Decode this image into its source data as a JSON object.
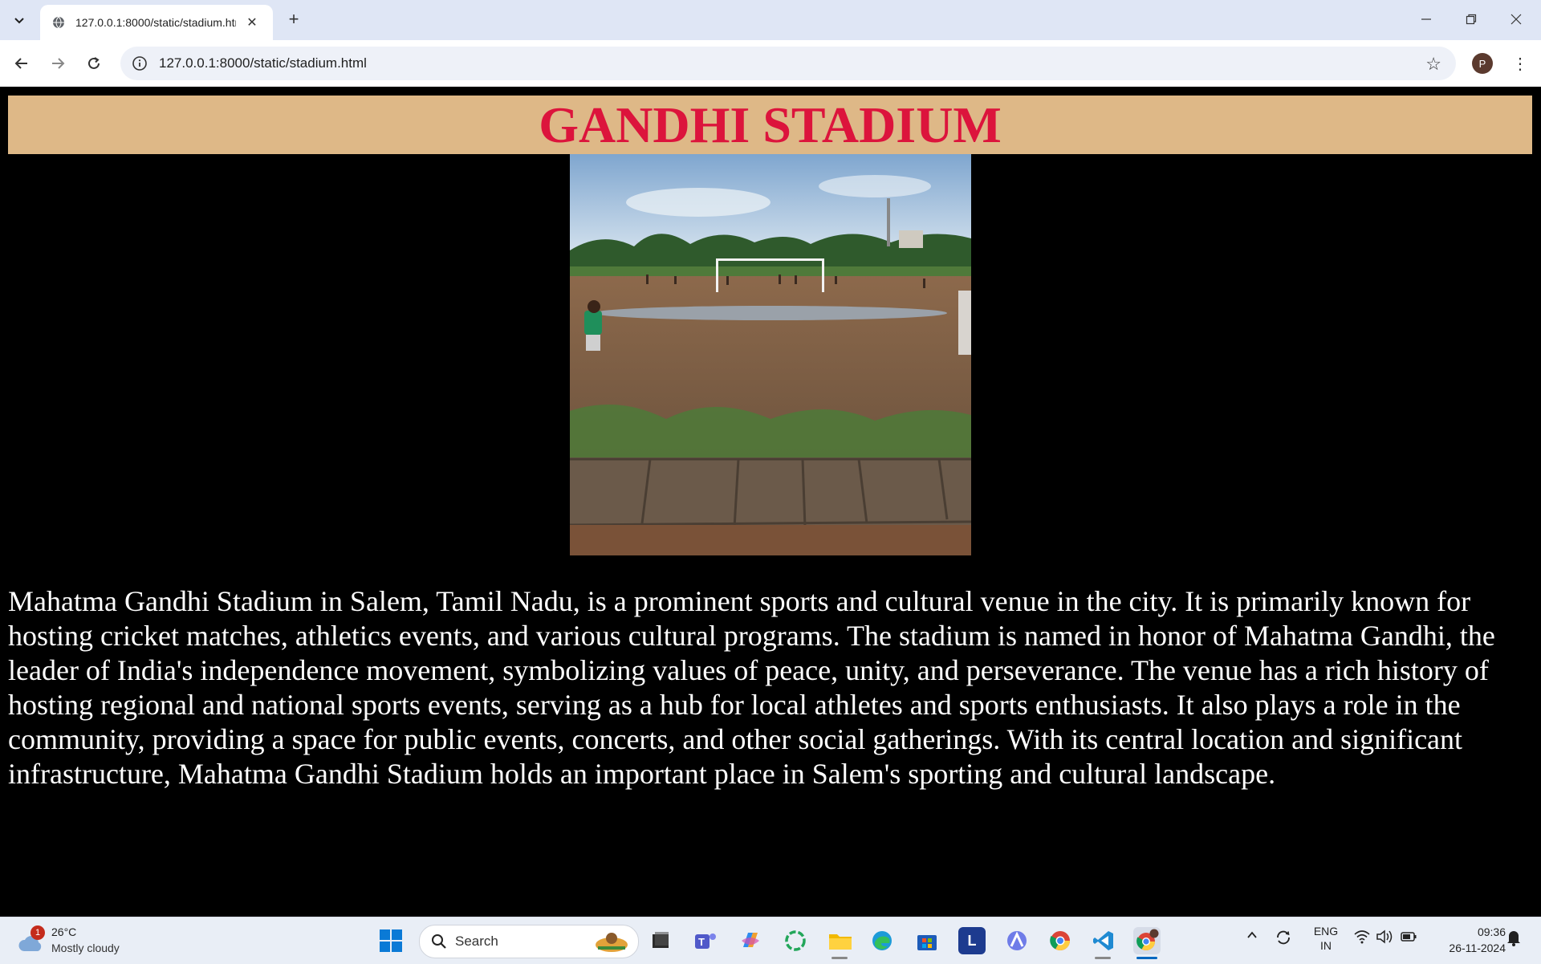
{
  "browser": {
    "tab_title": "127.0.0.1:8000/static/stadium.html",
    "new_tab_label": "+",
    "url": "127.0.0.1:8000/static/stadium.html",
    "profile_initial": "P"
  },
  "page": {
    "heading": "GANDHI STADIUM",
    "heading_color": "#dc143c",
    "banner_color": "#deb887",
    "image_alt": "Photo of a stadium ground",
    "description": "Mahatma Gandhi Stadium in Salem, Tamil Nadu, is a prominent sports and cultural venue in the city. It is primarily known for hosting cricket matches, athletics events, and various cultural programs. The stadium is named in honor of Mahatma Gandhi, the leader of India's independence movement, symbolizing values of peace, unity, and perseverance. The venue has a rich history of hosting regional and national sports events, serving as a hub for local athletes and sports enthusiasts. It also plays a role in the community, providing a space for public events, concerts, and other social gatherings. With its central location and significant infrastructure, Mahatma Gandhi Stadium holds an important place in Salem's sporting and cultural landscape."
  },
  "taskbar": {
    "weather_badge": "1",
    "weather_temp": "26°C",
    "weather_condition": "Mostly cloudy",
    "search_label": "Search",
    "apps": [
      "file-explorer-app",
      "teams-app",
      "copilot-app",
      "app-circle",
      "folder-app",
      "edge-app",
      "store-app",
      "l-app",
      "arc-app",
      "chrome-app",
      "vscode-app",
      "chrome-profile-app"
    ],
    "lang_line1": "ENG",
    "lang_line2": "IN",
    "time": "09:36",
    "date": "26-11-2024"
  }
}
